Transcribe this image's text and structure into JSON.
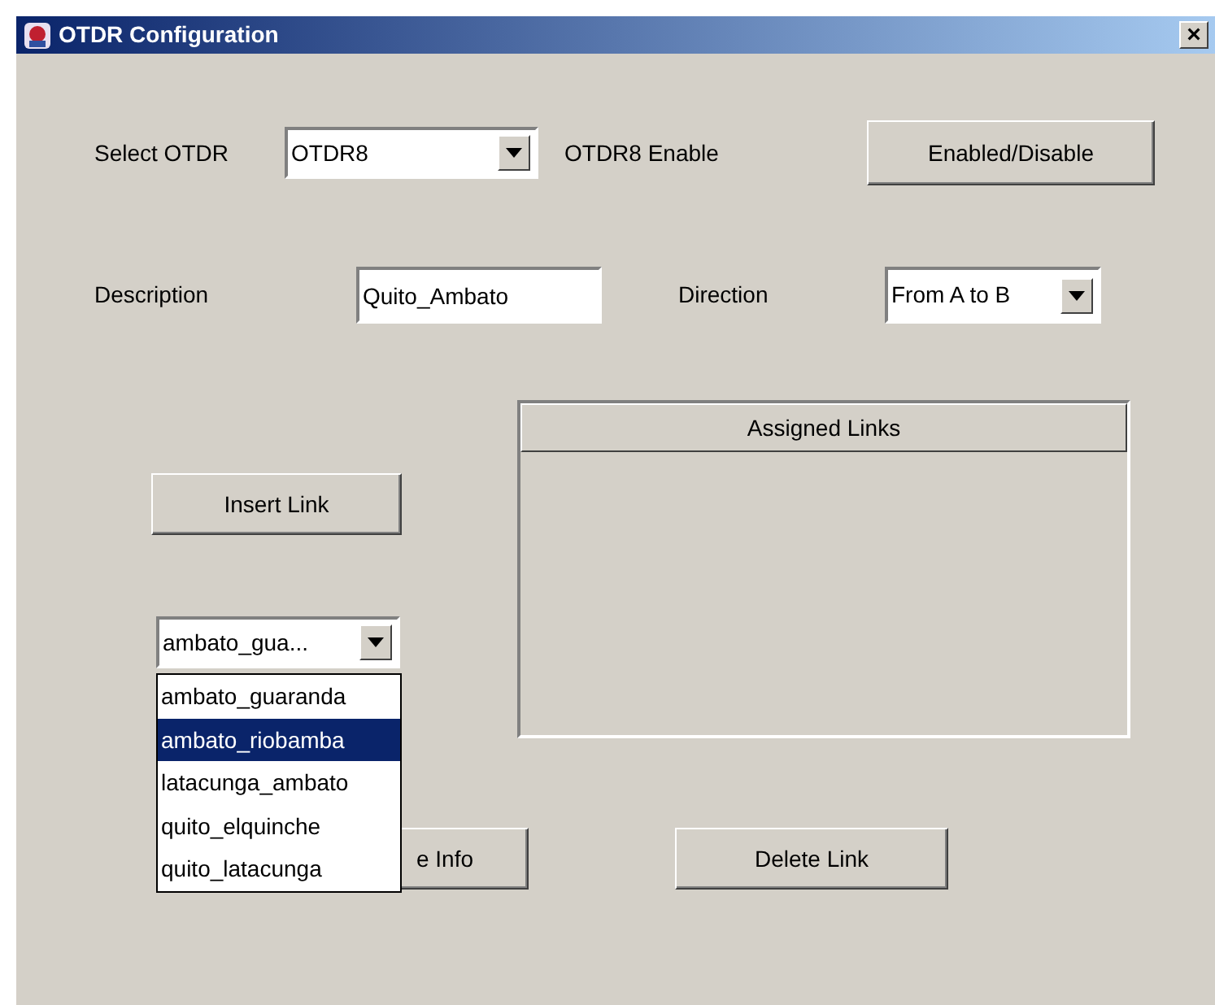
{
  "window": {
    "title": "OTDR Configuration",
    "close": "×"
  },
  "select_otdr": {
    "label": "Select OTDR",
    "value": "OTDR8"
  },
  "enable": {
    "label": "OTDR8 Enable",
    "button": "Enabled/Disable"
  },
  "description": {
    "label": "Description",
    "value": "Quito_Ambato"
  },
  "direction": {
    "label": "Direction",
    "value": "From A to B"
  },
  "insert_button": "Insert Link",
  "link_combo": {
    "value": "ambato_gua...",
    "expanded": true,
    "options": [
      {
        "label": "ambato_guaranda",
        "selected": false
      },
      {
        "label": "ambato_riobamba",
        "selected": true
      },
      {
        "label": "latacunga_ambato",
        "selected": false
      },
      {
        "label": "quito_elquinche",
        "selected": false
      },
      {
        "label": "quito_latacunga",
        "selected": false
      }
    ]
  },
  "assigned_links": {
    "header": "Assigned Links"
  },
  "info_button": "e Info",
  "delete_button": "Delete Link"
}
